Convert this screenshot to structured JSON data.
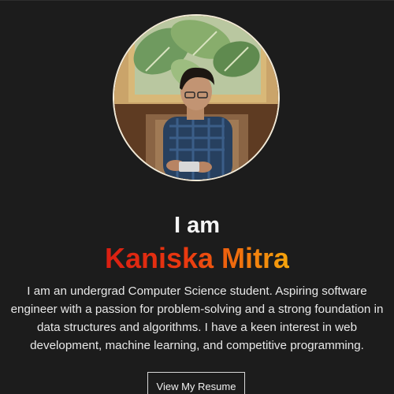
{
  "hero": {
    "intro": "I am",
    "name": "Kaniska Mitra",
    "bio": "I am an undergrad Computer Science student. Aspiring software engineer with a passion for problem-solving and a strong foundation in data structures and algorithms. I have a keen interest in web development, machine learning, and competitive programming.",
    "resume_button": "View My Resume"
  },
  "colors": {
    "background": "#1c1c1c",
    "name_gradient_start": "#d91e12",
    "name_gradient_end": "#f5a50c",
    "text": "#f5f5f5"
  },
  "icons": {
    "avatar": "profile-photo"
  }
}
